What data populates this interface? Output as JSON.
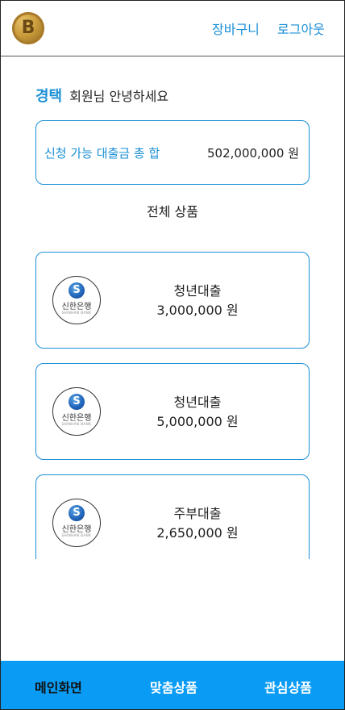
{
  "header": {
    "logo_icon": "bitcoin-coin-icon",
    "logo_glyph": "B",
    "cart_label": "장바구니",
    "logout_label": "로그아웃"
  },
  "greeting": {
    "name": "경택",
    "message": "회원님 안녕하세요"
  },
  "summary": {
    "label": "신청 가능 대출금 총 합",
    "value": "502,000,000 원"
  },
  "section": {
    "title": "전체 상품"
  },
  "products": [
    {
      "bank_name": "신한은행",
      "bank_sub": "SHINHAN BANK",
      "title": "청년대출",
      "amount": "3,000,000 원"
    },
    {
      "bank_name": "신한은행",
      "bank_sub": "SHINHAN BANK",
      "title": "청년대출",
      "amount": "5,000,000 원"
    },
    {
      "bank_name": "신한은행",
      "bank_sub": "SHINHAN BANK",
      "title": "주부대출",
      "amount": "2,650,000 원"
    }
  ],
  "bottom_nav": {
    "tabs": [
      {
        "label": "메인화면",
        "active": true
      },
      {
        "label": "맞춤상품",
        "active": false
      },
      {
        "label": "관심상품",
        "active": false
      }
    ]
  },
  "colors": {
    "accent": "#1a8fd6",
    "bottom_bar": "#0a9cf5",
    "active_tab_text": "#111111",
    "inactive_tab_text": "#ffffff"
  }
}
